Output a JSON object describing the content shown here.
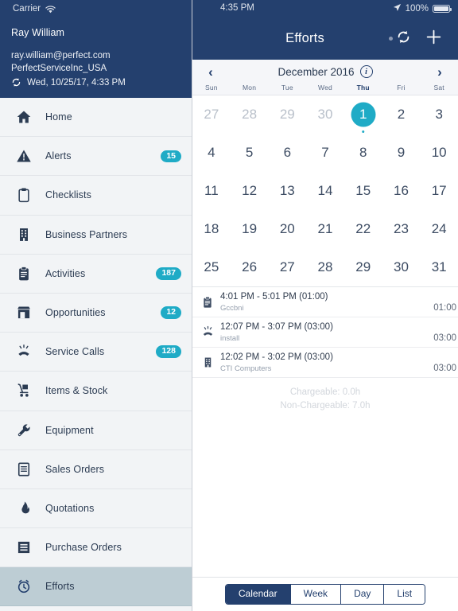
{
  "sidebar": {
    "status": {
      "carrier": "Carrier",
      "wifi_icon": "wifi-icon"
    },
    "user": {
      "name": "Ray William",
      "email": "ray.william@perfect.com",
      "company": "PerfectServiceInc_USA",
      "sync_icon": "sync-icon",
      "last_sync": "Wed, 10/25/17, 4:33 PM"
    },
    "items": [
      {
        "label": "Home",
        "icon": "home-icon",
        "badge": ""
      },
      {
        "label": "Alerts",
        "icon": "alert-triangle-icon",
        "badge": "15"
      },
      {
        "label": "Checklists",
        "icon": "clipboard-icon",
        "badge": ""
      },
      {
        "label": "Business Partners",
        "icon": "building-icon",
        "badge": ""
      },
      {
        "label": "Activities",
        "icon": "clipboard-lines-icon",
        "badge": "187"
      },
      {
        "label": "Opportunities",
        "icon": "storefront-icon",
        "badge": "12"
      },
      {
        "label": "Service Calls",
        "icon": "phone-ringing-icon",
        "badge": "128"
      },
      {
        "label": "Items & Stock",
        "icon": "hand-truck-icon",
        "badge": ""
      },
      {
        "label": "Equipment",
        "icon": "wrench-icon",
        "badge": ""
      },
      {
        "label": "Sales Orders",
        "icon": "document-lines-icon",
        "badge": ""
      },
      {
        "label": "Quotations",
        "icon": "flame-icon",
        "badge": ""
      },
      {
        "label": "Purchase Orders",
        "icon": "list-box-icon",
        "badge": ""
      },
      {
        "label": "Efforts",
        "icon": "alarm-clock-icon",
        "badge": "",
        "selected": true
      }
    ]
  },
  "main": {
    "status": {
      "time": "4:35 PM",
      "location_icon": "location-arrow-icon",
      "battery": "100%"
    },
    "nav": {
      "title": "Efforts",
      "sync_icon": "sync-icon",
      "add_icon": "plus-icon",
      "badge_dot": "unsynced-dot"
    },
    "calendar": {
      "prev_icon": "chevron-left-icon",
      "next_icon": "chevron-right-icon",
      "month": "December 2016",
      "info_icon": "info-icon",
      "weekdays": [
        "Sun",
        "Mon",
        "Tue",
        "Wed",
        "Thu",
        "Fri",
        "Sat"
      ],
      "current_weekday": "Thu",
      "weeks": [
        [
          {
            "d": "27",
            "dim": true
          },
          {
            "d": "28",
            "dim": true
          },
          {
            "d": "29",
            "dim": true
          },
          {
            "d": "30",
            "dim": true
          },
          {
            "d": "1",
            "today": true,
            "dot": true
          },
          {
            "d": "2"
          },
          {
            "d": "3"
          }
        ],
        [
          {
            "d": "4"
          },
          {
            "d": "5"
          },
          {
            "d": "6"
          },
          {
            "d": "7"
          },
          {
            "d": "8"
          },
          {
            "d": "9"
          },
          {
            "d": "10"
          }
        ],
        [
          {
            "d": "11"
          },
          {
            "d": "12"
          },
          {
            "d": "13"
          },
          {
            "d": "14"
          },
          {
            "d": "15"
          },
          {
            "d": "16"
          },
          {
            "d": "17"
          }
        ],
        [
          {
            "d": "18"
          },
          {
            "d": "19"
          },
          {
            "d": "20"
          },
          {
            "d": "21"
          },
          {
            "d": "22"
          },
          {
            "d": "23"
          },
          {
            "d": "24"
          }
        ],
        [
          {
            "d": "25"
          },
          {
            "d": "26"
          },
          {
            "d": "27"
          },
          {
            "d": "28"
          },
          {
            "d": "29"
          },
          {
            "d": "30"
          },
          {
            "d": "31"
          }
        ]
      ]
    },
    "events": [
      {
        "icon": "clipboard-lines-icon",
        "time": "4:01 PM - 5:01 PM (01:00)",
        "subject": "Gccbni",
        "duration": "01:00"
      },
      {
        "icon": "phone-ringing-icon",
        "time": "12:07 PM - 3:07 PM (03:00)",
        "subject": "install",
        "duration": "03:00"
      },
      {
        "icon": "building-icon",
        "time": "12:02 PM - 3:02 PM (03:00)",
        "subject": "CTI Computers",
        "duration": "03:00"
      }
    ],
    "summary": {
      "chargeable": "Chargeable: 0.0h",
      "non_chargeable": "Non-Chargeable: 7.0h"
    },
    "tabs": [
      {
        "label": "Calendar",
        "active": true
      },
      {
        "label": "Week",
        "active": false
      },
      {
        "label": "Day",
        "active": false
      },
      {
        "label": "List",
        "active": false
      }
    ]
  },
  "colors": {
    "navy": "#24406e",
    "teal": "#1fabc6",
    "sidebar_bg": "#f2f4f6",
    "selected": "#bdcdd4"
  }
}
